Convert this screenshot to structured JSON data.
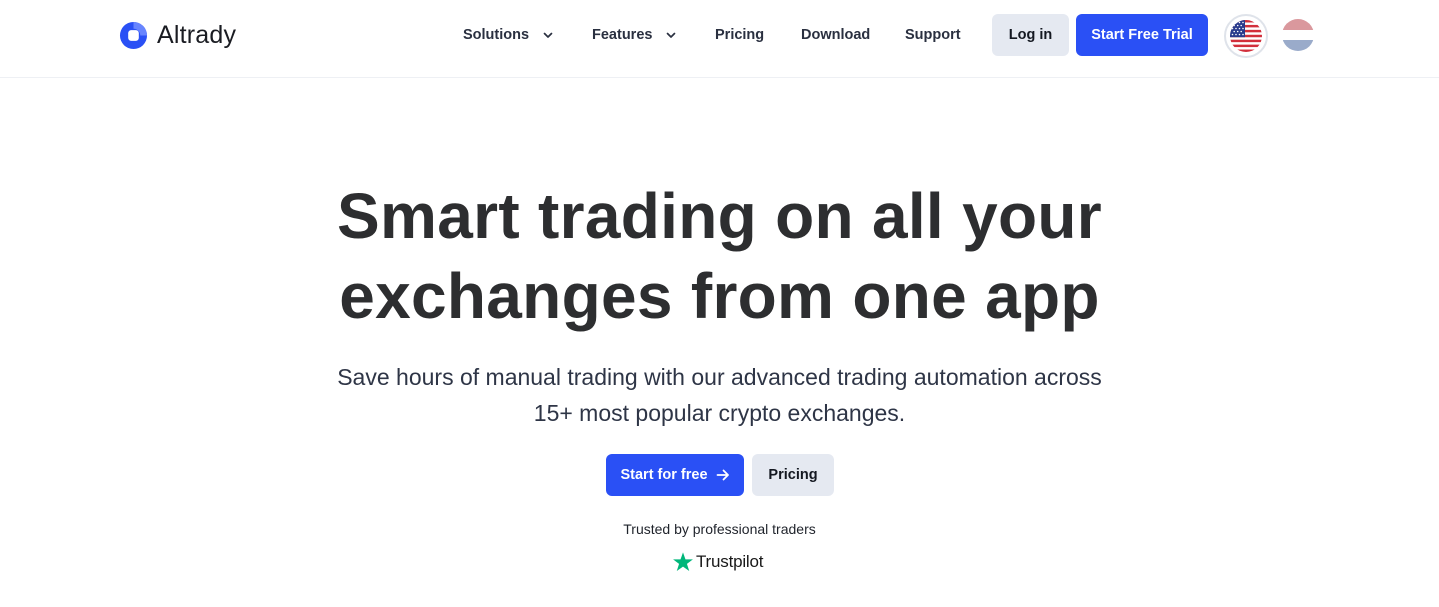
{
  "brand": {
    "name": "Altrady",
    "accent_color": "#2a50f5"
  },
  "nav": {
    "items": [
      {
        "label": "Solutions",
        "has_dropdown": true
      },
      {
        "label": "Features",
        "has_dropdown": true
      },
      {
        "label": "Pricing",
        "has_dropdown": false
      },
      {
        "label": "Download",
        "has_dropdown": false
      },
      {
        "label": "Support",
        "has_dropdown": false
      }
    ],
    "login_label": "Log in",
    "trial_label": "Start Free Trial",
    "languages": [
      {
        "icon": "us-flag-icon",
        "selected": true
      },
      {
        "icon": "nl-flag-icon",
        "selected": false
      }
    ]
  },
  "hero": {
    "title_lines": [
      "Smart trading on all your",
      "exchanges from one app"
    ],
    "subtitle_lines": [
      "Save hours of manual trading with our advanced trading automation across",
      "15+ most popular crypto exchanges."
    ],
    "primary_cta": "Start for free",
    "primary_cta_icon": "arrow-right-icon",
    "secondary_cta": "Pricing",
    "trusted_text": "Trusted by professional traders",
    "trustpilot_label": "Trustpilot",
    "trustpilot_color": "#00b67a"
  }
}
